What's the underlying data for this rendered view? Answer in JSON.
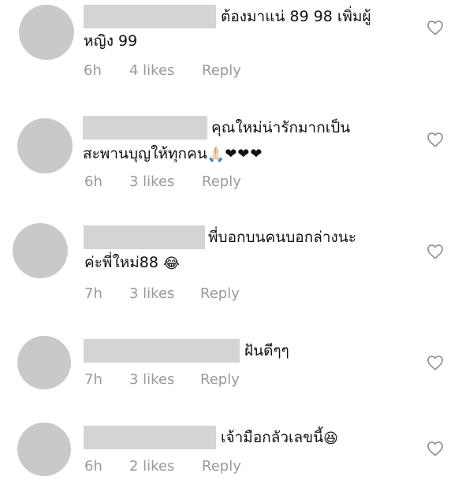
{
  "comments": [
    {
      "line1": "ต้องมาแน่ 89 98 เพิ่มผู้",
      "line2": "หญิง 99",
      "time": "6h",
      "likes": "4 likes",
      "reply": "Reply"
    },
    {
      "line1": "คุณใหม่น่ารักมากเป็น",
      "line2": "สะพานบุญให้ทุกคน",
      "line2_emoji": "🙏🏻",
      "line2_hearts": "❤❤❤",
      "time": "6h",
      "likes": "3 likes",
      "reply": "Reply"
    },
    {
      "line1": "พี่บอกบนคนบอกล่างนะ",
      "line2": "ค่ะพี่ใหม่88",
      "line2_emoji": "😂",
      "time": "7h",
      "likes": "3 likes",
      "reply": "Reply"
    },
    {
      "line1": "ฝันดีๆๆ",
      "time": "7h",
      "likes": "3 likes",
      "reply": "Reply"
    },
    {
      "line1": "เจ้ามือกลัวเลขนี้",
      "line1_emoji": "😆",
      "time": "6h",
      "likes": "2 likes",
      "reply": "Reply"
    }
  ],
  "icons": {
    "like": "heart-outline-icon"
  },
  "colors": {
    "avatar": "#c9c9c9",
    "name_redaction": "#d4d4d4",
    "meta_text": "#9a9a9a",
    "text": "#111111"
  }
}
